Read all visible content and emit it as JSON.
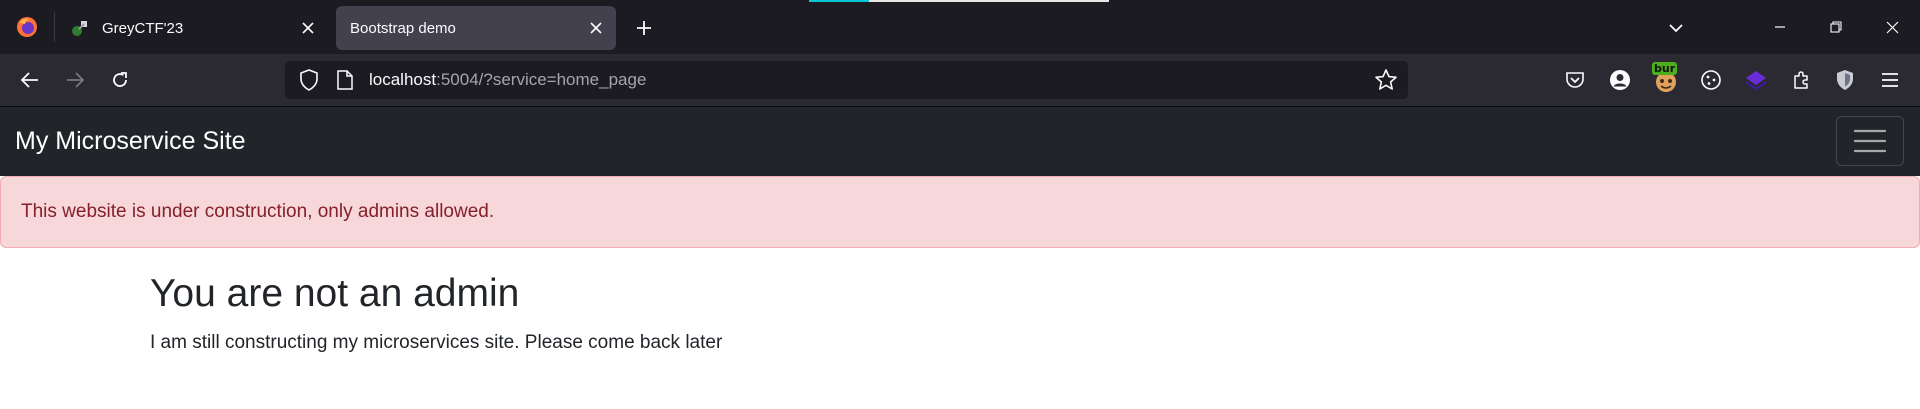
{
  "browser": {
    "tabs": [
      {
        "label": "GreyCTF'23",
        "active": false
      },
      {
        "label": "Bootstrap demo",
        "active": true
      }
    ],
    "url": {
      "host": "localhost",
      "rest": ":5004/?service=home_page"
    },
    "extensions": [
      "pocket-icon",
      "account-icon",
      "bur-extension-icon",
      "cookie-icon",
      "stack-extension-icon",
      "puzzle-extensions-icon",
      "shield-extension-icon",
      "menu-icon"
    ],
    "ext_badge": "bur",
    "accent": "#00c8d7"
  },
  "site": {
    "brand": "My Microservice Site",
    "alert": "This website is under construction, only admins allowed.",
    "heading": "You are not an admin",
    "body": "I am still constructing my microservices site. Please come back later"
  },
  "colors": {
    "tabbar": "#1c1b22",
    "toolbar": "#2b2a33",
    "navbar": "#212529",
    "alert_bg": "#f8d7da",
    "alert_text": "#842029"
  }
}
